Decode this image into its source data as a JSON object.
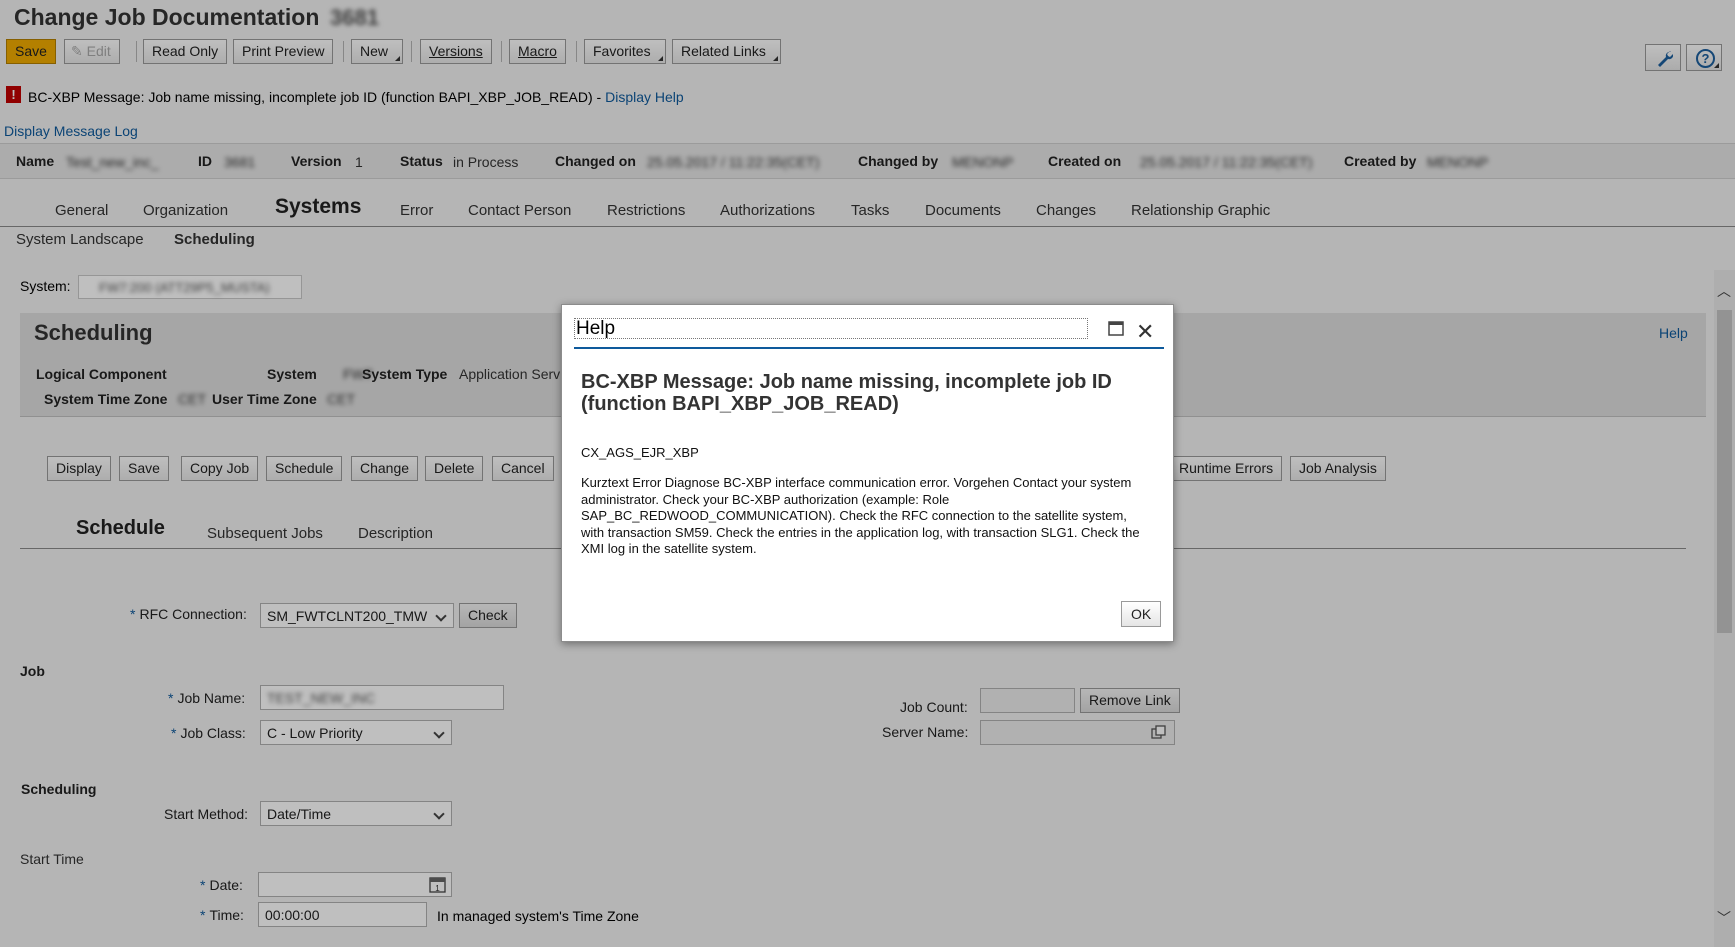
{
  "header": {
    "title": "Change Job Documentation",
    "title_id": "3681"
  },
  "toolbar": {
    "save": "Save",
    "edit": "Edit",
    "read_only": "Read Only",
    "print_preview": "Print Preview",
    "new": "New",
    "versions": "Versions",
    "macro": "Macro",
    "favorites": "Favorites",
    "related_links": "Related Links"
  },
  "message": {
    "text": "BC-XBP Message: Job name missing, incomplete job ID (function BAPI_XBP_JOB_READ) -",
    "help_link": "Display Help",
    "log_link": "Display Message Log"
  },
  "info": {
    "name_label": "Name",
    "name_value": "Test_new_inc_",
    "id_label": "ID",
    "id_value": "3681",
    "version_label": "Version",
    "version_value": "1",
    "status_label": "Status",
    "status_value": "in Process",
    "changed_on_label": "Changed on",
    "changed_on_value": "25.05.2017 / 11:22:35(CET)",
    "changed_by_label": "Changed by",
    "changed_by_value": "MENONP",
    "created_on_label": "Created on",
    "created_on_value": "25.05.2017 / 11:22:35(CET)",
    "created_by_label": "Created by",
    "created_by_value": "MENONP"
  },
  "tabs": [
    "General",
    "Organization",
    "Systems",
    "Error",
    "Contact Person",
    "Restrictions",
    "Authorizations",
    "Tasks",
    "Documents",
    "Changes",
    "Relationship Graphic"
  ],
  "subtabs": [
    "System Landscape",
    "Scheduling"
  ],
  "system": {
    "label": "System:",
    "value": "FW7:200 (ATT29P5_MUSTA)"
  },
  "scheduling": {
    "title": "Scheduling",
    "help": "Help",
    "logical_component_label": "Logical Component",
    "system_label": "System",
    "system_value": "FW7",
    "system_type_label": "System Type",
    "system_type_value": "Application Serv",
    "system_tz_label": "System Time Zone",
    "system_tz_value": "CET",
    "user_tz_label": "User Time Zone",
    "user_tz_value": "CET"
  },
  "actions": [
    "Display",
    "Save",
    "Copy Job",
    "Schedule",
    "Change",
    "Delete",
    "Cancel",
    "Runtime Errors",
    "Job Analysis"
  ],
  "inner_tabs": [
    "Schedule",
    "Subsequent Jobs",
    "Description"
  ],
  "form": {
    "rfc_label": "RFC Connection:",
    "rfc_value": "SM_FWTCLNT200_TMW",
    "check": "Check",
    "job_section": "Job",
    "job_name_label": "Job Name:",
    "job_name_value": "TEST_NEW_INC",
    "job_class_label": "Job Class:",
    "job_class_value": "C - Low Priority",
    "job_count_label": "Job Count:",
    "remove_link": "Remove Link",
    "server_name_label": "Server Name:",
    "scheduling_section": "Scheduling",
    "start_method_label": "Start Method:",
    "start_method_value": "Date/Time",
    "start_time_section": "Start Time",
    "date_label": "Date:",
    "time_label": "Time:",
    "time_value": "00:00:00",
    "tz_note": "In managed system's Time Zone"
  },
  "dialog": {
    "title": "Help",
    "heading": "BC-XBP Message: Job name missing, incomplete job ID (function BAPI_XBP_JOB_READ)",
    "code": "CX_AGS_EJR_XBP",
    "body": "Kurztext Error Diagnose BC-XBP interface communication error. Vorgehen Contact your system administrator. Check your BC-XBP authorization (example: Role SAP_BC_REDWOOD_COMMUNICATION). Check the RFC connection to the satellite system, with transaction SM59. Check the entries in the application log, with transaction SLG1. Check the XMI log in the satellite system.",
    "ok": "OK"
  },
  "colors": {
    "accent": "#0e5a9c",
    "save_button": "#f0ab00",
    "error": "#c00000"
  }
}
